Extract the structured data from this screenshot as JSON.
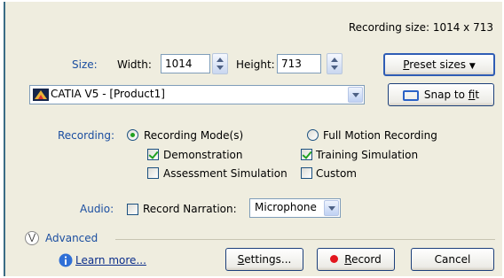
{
  "header": {
    "recording_size": "Recording size: 1014 x 713"
  },
  "size": {
    "label": "Size:",
    "width_label": "Width:",
    "width_value": "1014",
    "height_label": "Height:",
    "height_value": "713",
    "preset_button_pre": "",
    "preset_button_key": "P",
    "preset_button_post": "reset sizes"
  },
  "window_select": {
    "value": "CATIA V5 - [Product1]",
    "snap_button_pre": "Snap to ",
    "snap_button_key": "f",
    "snap_button_post": "it"
  },
  "recording": {
    "label": "Recording:",
    "mode_radio": "Recording Mode(s)",
    "full_motion_radio": "Full Motion Recording",
    "demonstration": "Demonstration",
    "training_simulation": "Training Simulation",
    "assessment_simulation": "Assessment Simulation",
    "custom": "Custom",
    "mode_selected": "Recording Mode(s)",
    "checked": [
      "Demonstration",
      "Training Simulation"
    ]
  },
  "audio": {
    "label": "Audio:",
    "record_narration": "Record Narration:",
    "source_value": "Microphone"
  },
  "advanced": {
    "label": "Advanced"
  },
  "footer": {
    "learn_more": "Learn more...",
    "settings_key": "S",
    "settings_rest": "ettings...",
    "record_key": "R",
    "record_rest": "ecord",
    "cancel": "Cancel"
  },
  "colors": {
    "panel_bg": "#efeddf",
    "label_blue": "#1b4ea0",
    "record_dot": "#e2161e",
    "check_green": "#21a121"
  }
}
